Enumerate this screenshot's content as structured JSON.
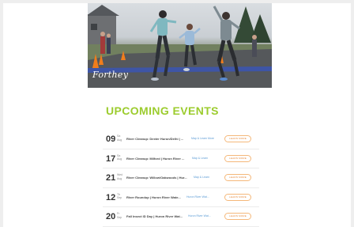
{
  "hero": {
    "logo_text": "Forthey",
    "logo_icon": "brand-script-logo"
  },
  "section": {
    "title": "UPCOMING EVENTS"
  },
  "events": [
    {
      "day": "09",
      "weekday": "Sa",
      "month": "Aug",
      "title": "River Cleanup: Dexter Huron/Delhi | ...",
      "link": "Map & Learn More",
      "button": "LEARN MORE"
    },
    {
      "day": "17",
      "weekday": "Sa",
      "month": "Aug",
      "title": "River Cleanup: Milford | Huron River ...",
      "link": "Map & Learn",
      "button": "LEARN MORE"
    },
    {
      "day": "21",
      "weekday": "Wed",
      "month": "Aug",
      "title": "River Cleanup: Willow/Oakwoods | Hur...",
      "link": "Map & Learn",
      "button": "LEARN MORE"
    },
    {
      "day": "12",
      "weekday": "Th",
      "month": "Sep",
      "title": "River Roundup | Huron River Wate...",
      "link": "Huron River Wat...",
      "button": "LEARN MORE"
    },
    {
      "day": "20",
      "weekday": "Fr",
      "month": "Sep",
      "title": "Fall Insect ID Day | Huron River Wat...",
      "link": "Huron River Wat...",
      "button": "LEARN MORE"
    }
  ],
  "colors": {
    "accent_green": "#9ccc2e",
    "button_orange": "#e68a3c",
    "link_blue": "#5b9bd5"
  }
}
